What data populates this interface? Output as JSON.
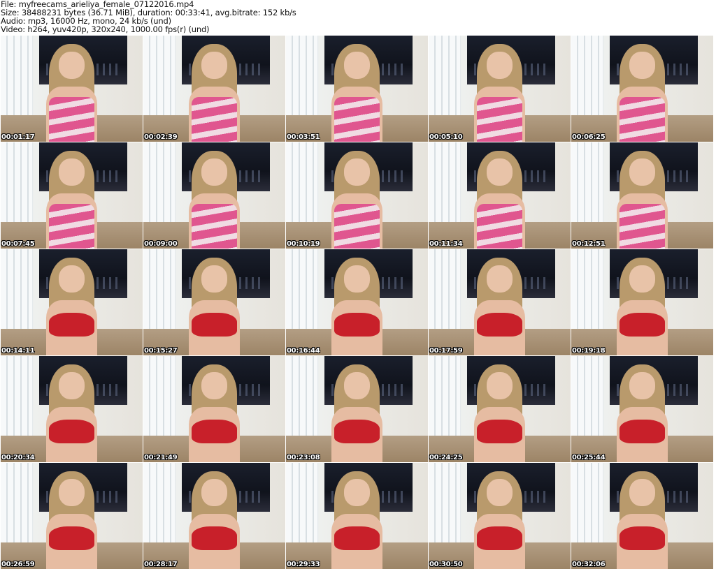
{
  "header": {
    "file": "File: myfreecams_arieliya_female_07122016.mp4",
    "size": "Size: 38488231 bytes (36.71 MiB), duration: 00:33:41, avg.bitrate: 152 kb/s",
    "audio": "Audio: mp3, 16000 Hz, mono, 24 kb/s (und)",
    "video": "Video: h264, yuv420p, 320x240, 1000.00 fps(r) (und)"
  },
  "thumbnails": [
    {
      "time": "00:01:17",
      "top": "pink"
    },
    {
      "time": "00:02:39",
      "top": "pink"
    },
    {
      "time": "00:03:51",
      "top": "pink"
    },
    {
      "time": "00:05:10",
      "top": "pink"
    },
    {
      "time": "00:06:25",
      "top": "pink"
    },
    {
      "time": "00:07:45",
      "top": "pink"
    },
    {
      "time": "00:09:00",
      "top": "pink"
    },
    {
      "time": "00:10:19",
      "top": "pink"
    },
    {
      "time": "00:11:34",
      "top": "pink"
    },
    {
      "time": "00:12:51",
      "top": "pink"
    },
    {
      "time": "00:14:11",
      "top": "red"
    },
    {
      "time": "00:15:27",
      "top": "red"
    },
    {
      "time": "00:16:44",
      "top": "red"
    },
    {
      "time": "00:17:59",
      "top": "red"
    },
    {
      "time": "00:19:18",
      "top": "red"
    },
    {
      "time": "00:20:34",
      "top": "red"
    },
    {
      "time": "00:21:49",
      "top": "red"
    },
    {
      "time": "00:23:08",
      "top": "red"
    },
    {
      "time": "00:24:25",
      "top": "red"
    },
    {
      "time": "00:25:44",
      "top": "red"
    },
    {
      "time": "00:26:59",
      "top": "red"
    },
    {
      "time": "00:28:17",
      "top": "red"
    },
    {
      "time": "00:29:33",
      "top": "red"
    },
    {
      "time": "00:30:50",
      "top": "red"
    },
    {
      "time": "00:32:06",
      "top": "red"
    }
  ]
}
